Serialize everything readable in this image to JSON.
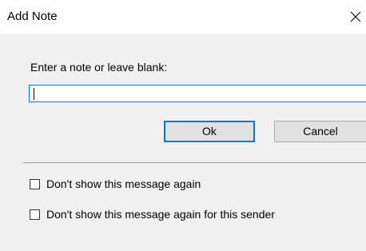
{
  "window": {
    "title": "Add Note",
    "close_icon": "close-icon"
  },
  "form": {
    "prompt": "Enter a note or leave blank:",
    "note_value": "",
    "ok_label": "Ok",
    "cancel_label": "Cancel"
  },
  "options": {
    "dont_show_again": "Don't show this message again",
    "dont_show_again_sender": "Don't show this message again for this sender"
  },
  "colors": {
    "accent": "#0078d7",
    "panel_bg": "#f0f0f0",
    "button_bg": "#e1e1e1"
  }
}
